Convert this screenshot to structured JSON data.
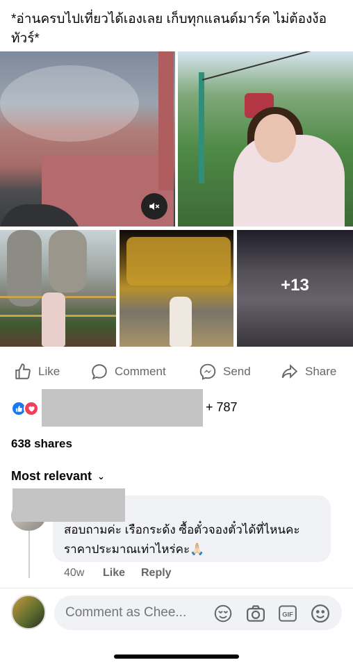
{
  "post": {
    "caption": "*อ่านครบไปเที่ยวได้เองเลย เก็บทุกแลนด์มาร์ค ไม่ต้องง้อทัวร์*",
    "more_photos_label": "+13"
  },
  "actions": {
    "like": "Like",
    "comment": "Comment",
    "send": "Send",
    "share": "Share"
  },
  "stats": {
    "reaction_count": "+ 787",
    "shares": "638 shares"
  },
  "comments": {
    "sort_label": "Most relevant",
    "items": [
      {
        "text": "สอบถามค่ะ เรือกระด้ง ซื้อตั๋วจองตั๋วได้ที่ไหนคะ ราคาประมาณเท่าไหร่คะ🙏🏻",
        "time": "40w",
        "like_label": "Like",
        "reply_label": "Reply"
      }
    ]
  },
  "composer": {
    "placeholder": "Comment as Chee..."
  },
  "colors": {
    "accent": "#1877f2",
    "love": "#f33e58",
    "muted_text": "#65676b",
    "bubble_bg": "#f0f2f5"
  },
  "icons": [
    "mute-icon",
    "like-thumb-icon",
    "comment-bubble-icon",
    "messenger-icon",
    "share-arrow-icon",
    "avatar-sticker-icon",
    "camera-icon",
    "gif-icon",
    "emoji-icon",
    "chevron-down-icon"
  ]
}
